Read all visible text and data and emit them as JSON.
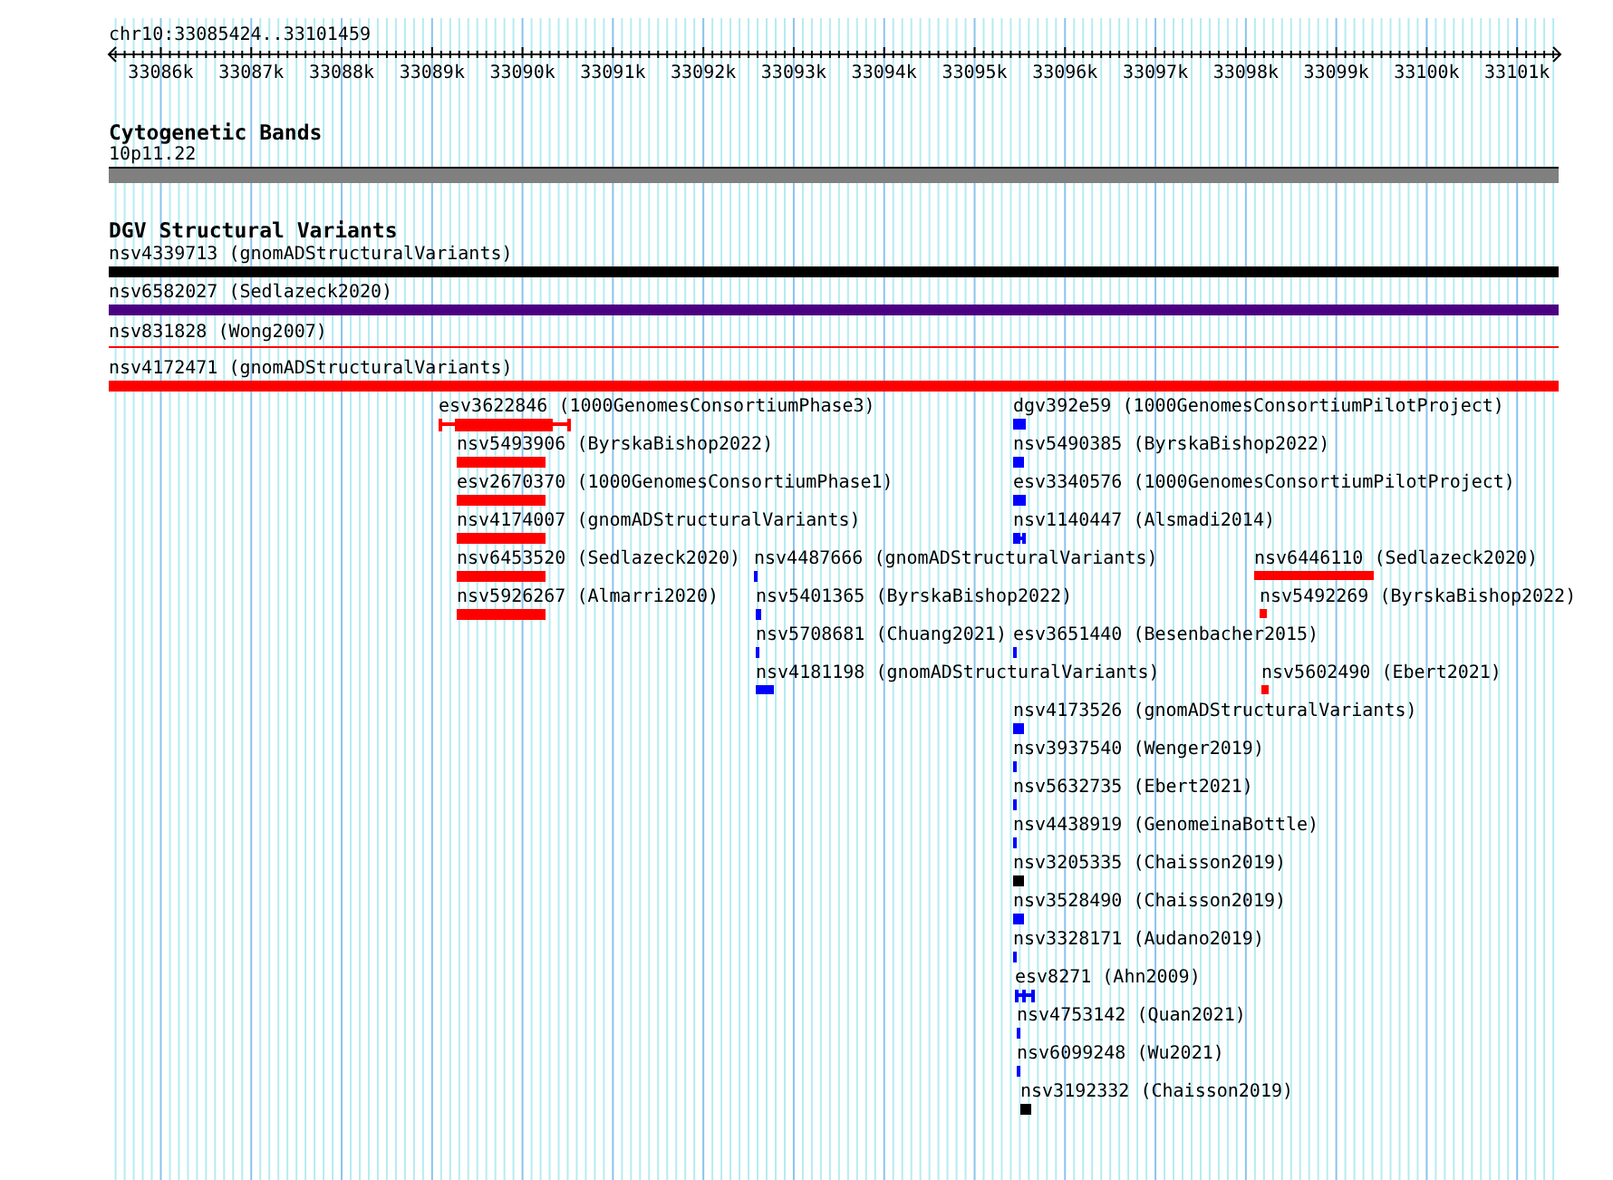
{
  "location": "chr10:33085424..33101459",
  "ruler": {
    "tick_labels": [
      "33086k",
      "33087k",
      "33088k",
      "33089k",
      "33090k",
      "33091k",
      "33092k",
      "33093k",
      "33094k",
      "33095k",
      "33096k",
      "33097k",
      "33098k",
      "33099k",
      "33100k",
      "33101k"
    ]
  },
  "cytogenetic_bands": {
    "title": "Cytogenetic Bands",
    "band": {
      "label": "10p11.22",
      "color": "#808080"
    }
  },
  "dgv_structural_variants": {
    "title": "DGV Structural Variants",
    "features": [
      {
        "label": "nsv4339713 (gnomADStructuralVariants)",
        "color": "#000000",
        "kind": "bar"
      },
      {
        "label": "nsv6582027 (Sedlazeck2020)",
        "color": "#4b0082",
        "kind": "bar"
      },
      {
        "label": "nsv831828 (Wong2007)",
        "color": "#ff0000",
        "kind": "line"
      },
      {
        "label": "nsv4172471 (gnomADStructuralVariants)",
        "color": "#ff0000",
        "kind": "bar"
      },
      {
        "label": "esv3622846 (1000GenomesConsortiumPhase3)",
        "color": "#ff0000",
        "kind": "whisker"
      },
      {
        "label": "nsv5493906 (ByrskaBishop2022)",
        "color": "#ff0000",
        "kind": "bar"
      },
      {
        "label": "esv2670370 (1000GenomesConsortiumPhase1)",
        "color": "#ff0000",
        "kind": "bar"
      },
      {
        "label": "nsv4174007 (gnomADStructuralVariants)",
        "color": "#ff0000",
        "kind": "bar"
      },
      {
        "label": "nsv6453520 (Sedlazeck2020)",
        "color": "#ff0000",
        "kind": "bar"
      },
      {
        "label": "nsv5926267 (Almarri2020)",
        "color": "#ff0000",
        "kind": "bar"
      },
      {
        "label": "nsv4487666 (gnomADStructuralVariants)",
        "color": "#0000ff",
        "kind": "bar"
      },
      {
        "label": "nsv5401365 (ByrskaBishop2022)",
        "color": "#0000ff",
        "kind": "bar"
      },
      {
        "label": "nsv5708681 (Chuang2021)",
        "color": "#0000ff",
        "kind": "bar"
      },
      {
        "label": "nsv4181198 (gnomADStructuralVariants)",
        "color": "#0000ff",
        "kind": "bar"
      },
      {
        "label": "dgv392e59 (1000GenomesConsortiumPilotProject)",
        "color": "#0000ff",
        "kind": "bar"
      },
      {
        "label": "nsv5490385 (ByrskaBishop2022)",
        "color": "#0000ff",
        "kind": "bar"
      },
      {
        "label": "esv3340576 (1000GenomesConsortiumPilotProject)",
        "color": "#0000ff",
        "kind": "bar"
      },
      {
        "label": "nsv1140447 (Alsmadi2014)",
        "color": "#0000ff",
        "kind": "whisker"
      },
      {
        "label": "esv3651440 (Besenbacher2015)",
        "color": "#0000ff",
        "kind": "bar"
      },
      {
        "label": "nsv6446110 (Sedlazeck2020)",
        "color": "#ff0000",
        "kind": "bar"
      },
      {
        "label": "nsv5492269 (ByrskaBishop2022)",
        "color": "#ff0000",
        "kind": "bar"
      },
      {
        "label": "nsv5602490 (Ebert2021)",
        "color": "#ff0000",
        "kind": "bar"
      },
      {
        "label": "nsv4173526 (gnomADStructuralVariants)",
        "color": "#0000ff",
        "kind": "bar"
      },
      {
        "label": "nsv3937540 (Wenger2019)",
        "color": "#0000ff",
        "kind": "bar"
      },
      {
        "label": "nsv5632735 (Ebert2021)",
        "color": "#0000ff",
        "kind": "bar"
      },
      {
        "label": "nsv4438919 (GenomeinaBottle)",
        "color": "#0000ff",
        "kind": "bar"
      },
      {
        "label": "nsv3205335 (Chaisson2019)",
        "color": "#000000",
        "kind": "bar"
      },
      {
        "label": "nsv3528490 (Chaisson2019)",
        "color": "#0000ff",
        "kind": "bar"
      },
      {
        "label": "nsv3328171 (Audano2019)",
        "color": "#0000ff",
        "kind": "bar"
      },
      {
        "label": "esv8271 (Ahn2009)",
        "color": "#0000ff",
        "kind": "whisker"
      },
      {
        "label": "nsv4753142 (Quan2021)",
        "color": "#0000ff",
        "kind": "bar"
      },
      {
        "label": "nsv6099248 (Wu2021)",
        "color": "#0000ff",
        "kind": "bar"
      },
      {
        "label": "nsv3192332 (Chaisson2019)",
        "color": "#000000",
        "kind": "bar"
      }
    ]
  }
}
